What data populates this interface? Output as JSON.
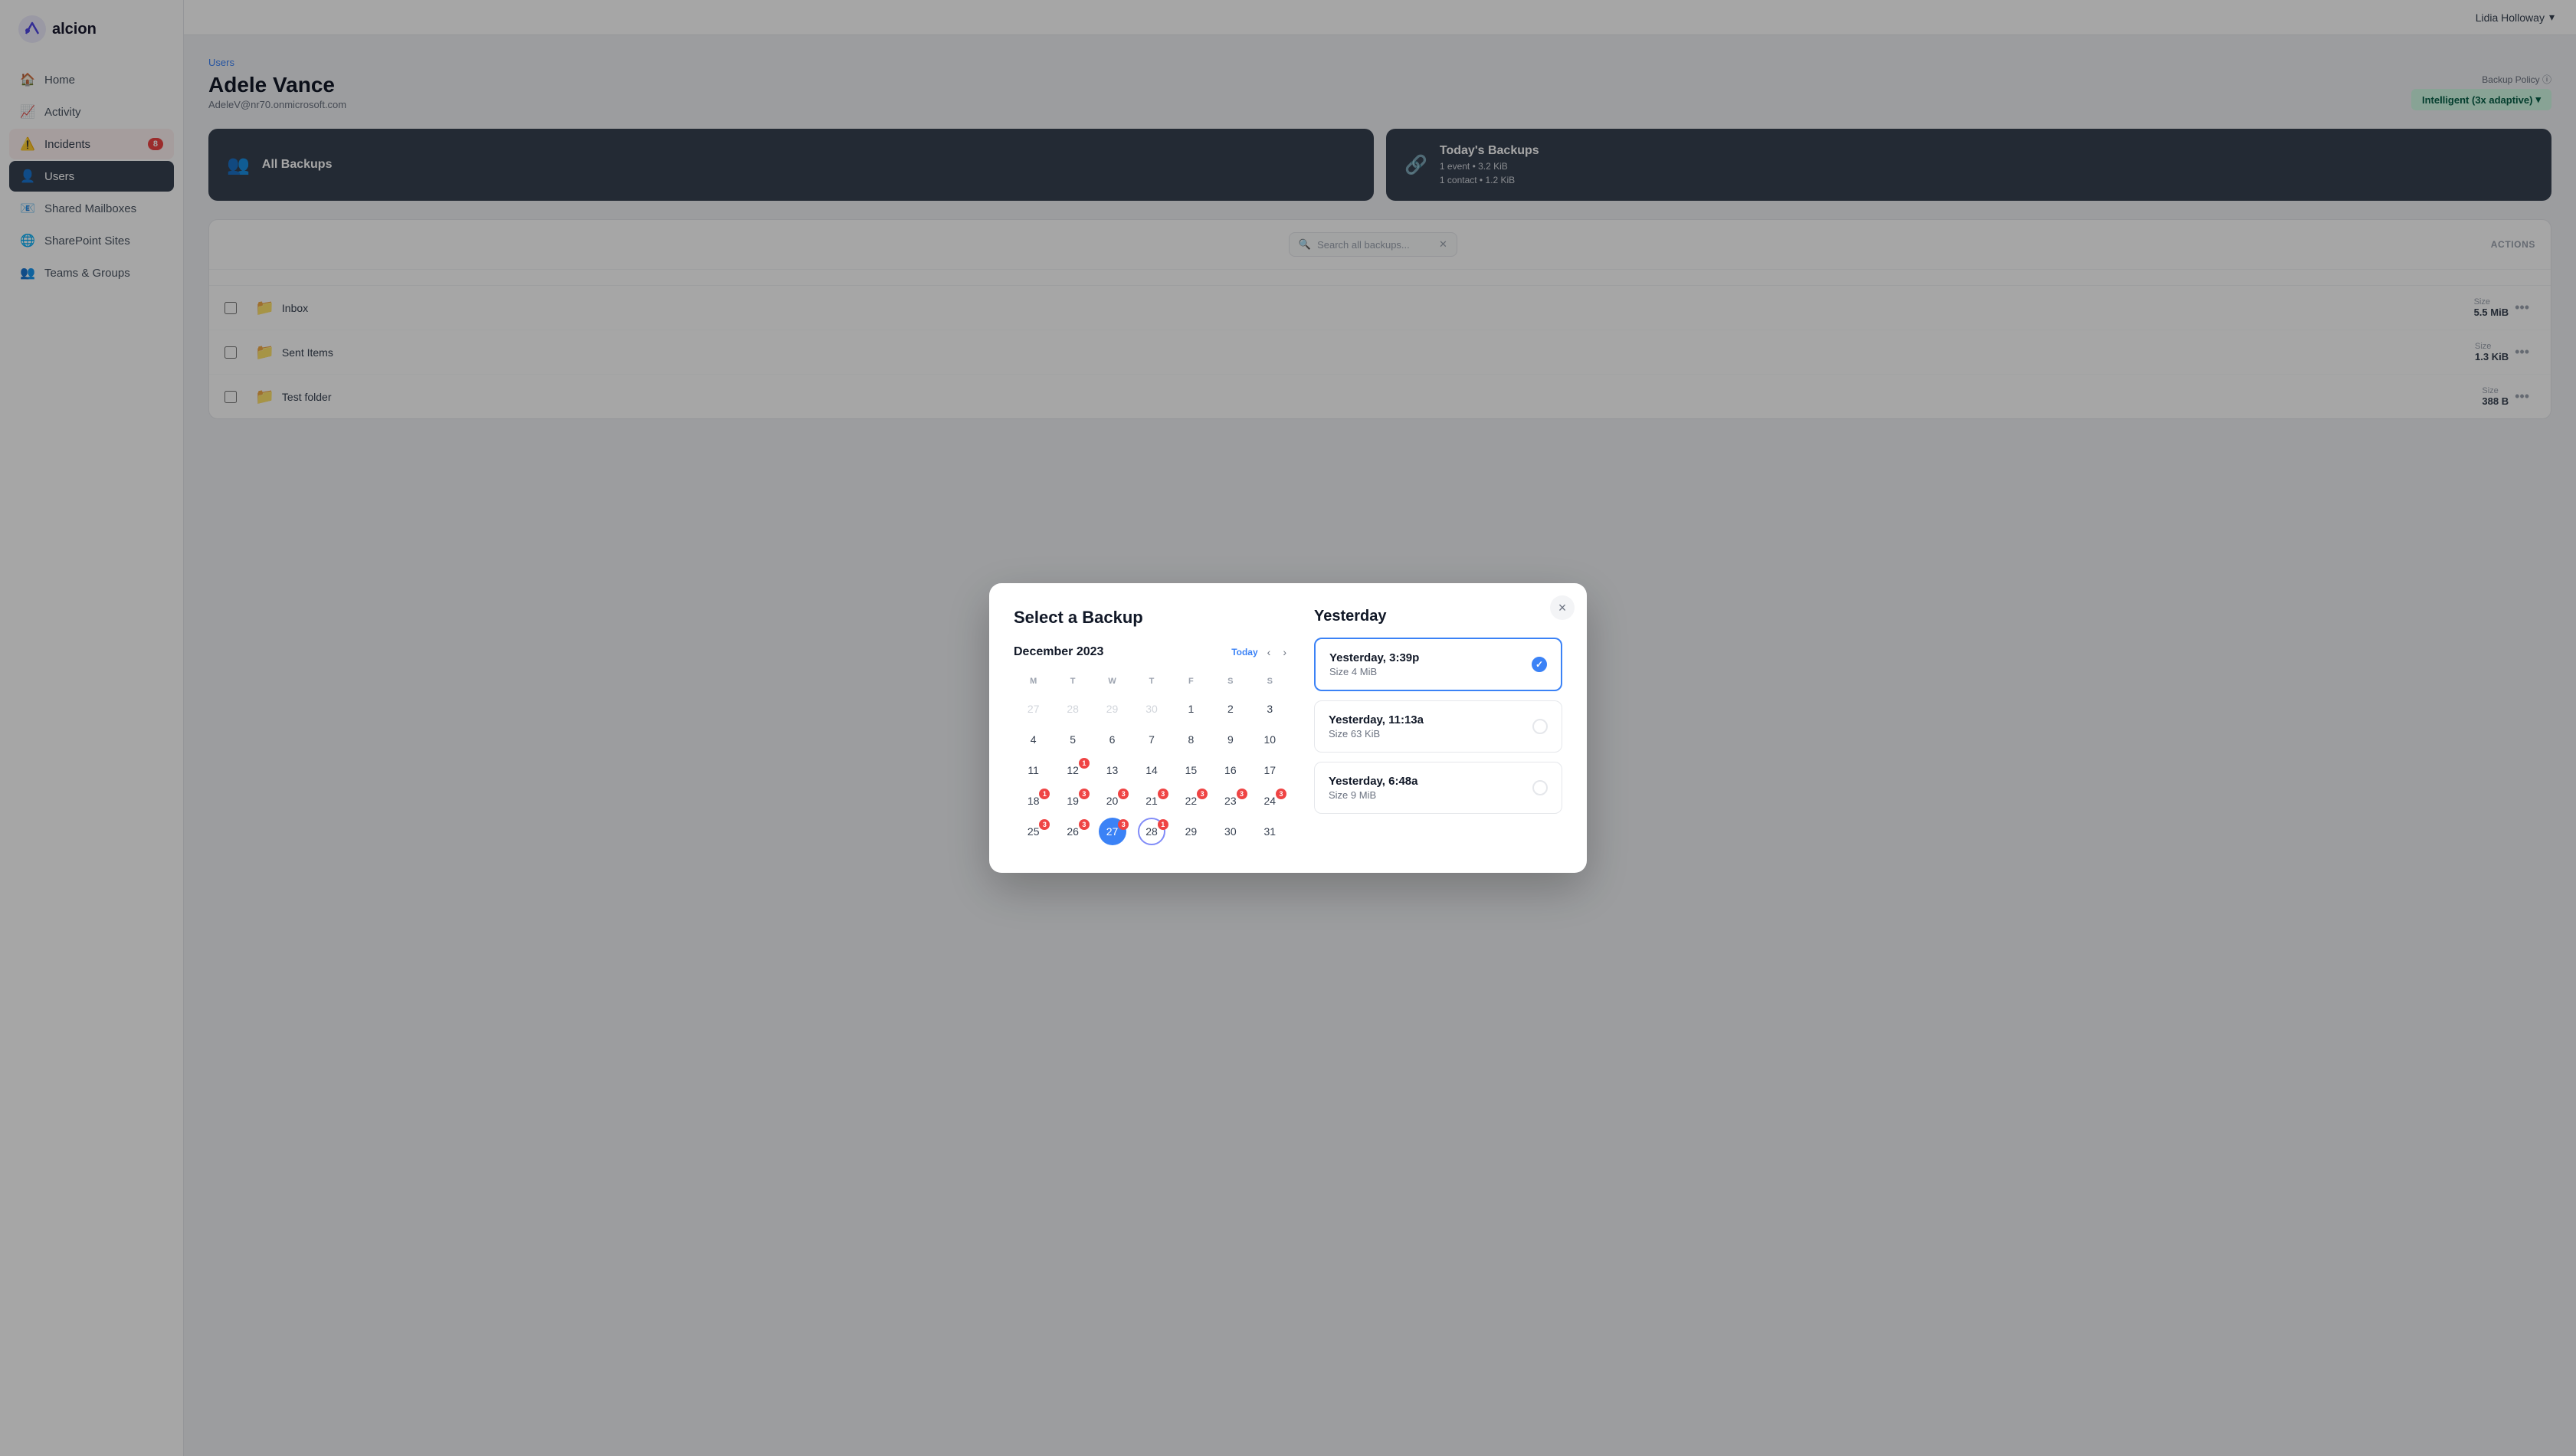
{
  "app": {
    "name": "alcion",
    "user": "Lidia Holloway"
  },
  "sidebar": {
    "items": [
      {
        "id": "home",
        "label": "Home",
        "icon": "🏠",
        "active": false
      },
      {
        "id": "activity",
        "label": "Activity",
        "icon": "📈",
        "active": false
      },
      {
        "id": "incidents",
        "label": "Incidents",
        "icon": "⚠️",
        "active": false,
        "badge": "8"
      },
      {
        "id": "users",
        "label": "Users",
        "icon": "👤",
        "active": true
      },
      {
        "id": "shared-mailboxes",
        "label": "Shared Mailboxes",
        "icon": "📧",
        "active": false
      },
      {
        "id": "sharepoint-sites",
        "label": "SharePoint Sites",
        "icon": "🌐",
        "active": false
      },
      {
        "id": "teams-groups",
        "label": "Teams & Groups",
        "icon": "👥",
        "active": false
      }
    ]
  },
  "page": {
    "breadcrumb": "Users",
    "title": "Adele Vance",
    "subtitle": "AdeleV@nr70.onmicrosoft.com",
    "backup_policy_label": "Backup Policy ⓘ",
    "backup_policy_value": "Intelligent (3x adaptive)"
  },
  "backup_cards": [
    {
      "id": "all-backups",
      "title": "All Backups",
      "icon": "👥",
      "detail": ""
    },
    {
      "id": "todays-backups",
      "title": "Today's Backups",
      "icon": "🔗",
      "details": [
        "1 event • 3.2 KiB",
        "1 contact • 1.2 KiB"
      ]
    }
  ],
  "files_toolbar": {
    "search_placeholder": "Search all backups...",
    "actions_label": "ACTIONS"
  },
  "files": [
    {
      "name": "Inbox",
      "size_label": "Size",
      "size": "5.5 MiB"
    },
    {
      "name": "Sent Items",
      "size_label": "Size",
      "size": "1.3 KiB"
    },
    {
      "name": "Test folder",
      "size_label": "Size",
      "size": "388 B"
    }
  ],
  "modal": {
    "title": "Select a Backup",
    "close_label": "×",
    "calendar": {
      "month_year": "December 2023",
      "today_btn": "Today",
      "days_of_week": [
        "M",
        "T",
        "W",
        "T",
        "F",
        "S",
        "S"
      ],
      "weeks": [
        [
          {
            "num": "27",
            "other": true,
            "badge": null,
            "today": false,
            "selected": false,
            "ring": false
          },
          {
            "num": "28",
            "other": true,
            "badge": null,
            "today": false,
            "selected": false,
            "ring": false
          },
          {
            "num": "29",
            "other": true,
            "badge": null,
            "today": false,
            "selected": false,
            "ring": false
          },
          {
            "num": "30",
            "other": true,
            "badge": null,
            "today": false,
            "selected": false,
            "ring": false
          },
          {
            "num": "1",
            "other": false,
            "badge": null,
            "today": false,
            "selected": false,
            "ring": false
          },
          {
            "num": "2",
            "other": false,
            "badge": null,
            "today": false,
            "selected": false,
            "ring": false
          },
          {
            "num": "3",
            "other": false,
            "badge": null,
            "today": false,
            "selected": false,
            "ring": false
          }
        ],
        [
          {
            "num": "4",
            "other": false,
            "badge": null,
            "today": false,
            "selected": false,
            "ring": false
          },
          {
            "num": "5",
            "other": false,
            "badge": null,
            "today": false,
            "selected": false,
            "ring": false
          },
          {
            "num": "6",
            "other": false,
            "badge": null,
            "today": false,
            "selected": false,
            "ring": false
          },
          {
            "num": "7",
            "other": false,
            "badge": null,
            "today": false,
            "selected": false,
            "ring": false
          },
          {
            "num": "8",
            "other": false,
            "badge": null,
            "today": false,
            "selected": false,
            "ring": false
          },
          {
            "num": "9",
            "other": false,
            "badge": null,
            "today": false,
            "selected": false,
            "ring": false
          },
          {
            "num": "10",
            "other": false,
            "badge": null,
            "today": false,
            "selected": false,
            "ring": false
          }
        ],
        [
          {
            "num": "11",
            "other": false,
            "badge": null,
            "today": false,
            "selected": false,
            "ring": false
          },
          {
            "num": "12",
            "other": false,
            "badge": "1",
            "today": false,
            "selected": false,
            "ring": false
          },
          {
            "num": "13",
            "other": false,
            "badge": null,
            "today": false,
            "selected": false,
            "ring": false
          },
          {
            "num": "14",
            "other": false,
            "badge": null,
            "today": false,
            "selected": false,
            "ring": false
          },
          {
            "num": "15",
            "other": false,
            "badge": null,
            "today": false,
            "selected": false,
            "ring": false
          },
          {
            "num": "16",
            "other": false,
            "badge": null,
            "today": false,
            "selected": false,
            "ring": false
          },
          {
            "num": "17",
            "other": false,
            "badge": null,
            "today": false,
            "selected": false,
            "ring": false
          }
        ],
        [
          {
            "num": "18",
            "other": false,
            "badge": "1",
            "today": false,
            "selected": false,
            "ring": false
          },
          {
            "num": "19",
            "other": false,
            "badge": "3",
            "today": false,
            "selected": false,
            "ring": false
          },
          {
            "num": "20",
            "other": false,
            "badge": "3",
            "today": false,
            "selected": false,
            "ring": false
          },
          {
            "num": "21",
            "other": false,
            "badge": "3",
            "today": false,
            "selected": false,
            "ring": false
          },
          {
            "num": "22",
            "other": false,
            "badge": "3",
            "today": false,
            "selected": false,
            "ring": false
          },
          {
            "num": "23",
            "other": false,
            "badge": "3",
            "today": false,
            "selected": false,
            "ring": false
          },
          {
            "num": "24",
            "other": false,
            "badge": "3",
            "today": false,
            "selected": false,
            "ring": false
          }
        ],
        [
          {
            "num": "25",
            "other": false,
            "badge": "3",
            "today": false,
            "selected": false,
            "ring": false
          },
          {
            "num": "26",
            "other": false,
            "badge": "3",
            "today": false,
            "selected": false,
            "ring": false
          },
          {
            "num": "27",
            "other": false,
            "badge": "3",
            "today": true,
            "selected": false,
            "ring": false
          },
          {
            "num": "28",
            "other": false,
            "badge": "1",
            "today": false,
            "selected": true,
            "ring": true
          },
          {
            "num": "29",
            "other": false,
            "badge": null,
            "today": false,
            "selected": false,
            "ring": false
          },
          {
            "num": "30",
            "other": false,
            "badge": null,
            "today": false,
            "selected": false,
            "ring": false
          },
          {
            "num": "31",
            "other": false,
            "badge": null,
            "today": false,
            "selected": false,
            "ring": false
          }
        ]
      ]
    },
    "section_title": "Yesterday",
    "backups": [
      {
        "time": "Yesterday, 3:39p",
        "size": "Size 4 MiB",
        "selected": true
      },
      {
        "time": "Yesterday, 11:13a",
        "size": "Size 63 KiB",
        "selected": false
      },
      {
        "time": "Yesterday, 6:48a",
        "size": "Size 9 MiB",
        "selected": false
      }
    ]
  }
}
